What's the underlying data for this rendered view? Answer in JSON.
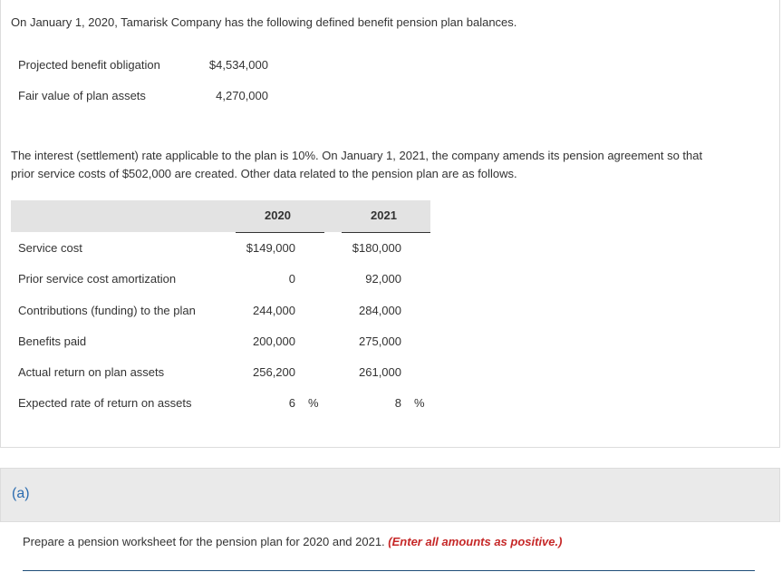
{
  "intro": "On January 1, 2020, Tamarisk Company has the following defined benefit pension plan balances.",
  "balances": [
    {
      "label": "Projected benefit obligation",
      "value": "$4,534,000"
    },
    {
      "label": "Fair value of plan assets",
      "value": "4,270,000"
    }
  ],
  "paragraph_line1": "The interest (settlement) rate applicable to the plan is 10%. On January 1, 2021, the company amends its pension agreement so that",
  "paragraph_line2": "prior service costs of $502,000 are created. Other data related to the pension plan are as follows.",
  "table": {
    "headers": [
      "2020",
      "2021"
    ],
    "rows": [
      {
        "label": "Service cost",
        "v2020": "$149,000",
        "v2021": "$180,000"
      },
      {
        "label": "Prior service cost amortization",
        "v2020": "0",
        "v2021": "92,000"
      },
      {
        "label": "Contributions (funding) to the plan",
        "v2020": "244,000",
        "v2021": "284,000"
      },
      {
        "label": "Benefits paid",
        "v2020": "200,000",
        "v2021": "275,000"
      },
      {
        "label": "Actual return on plan assets",
        "v2020": "256,200",
        "v2021": "261,000"
      },
      {
        "label": "Expected rate of return on assets",
        "v2020": "6",
        "v2021": "8",
        "unit": "%"
      }
    ]
  },
  "part_label": "(a)",
  "instruction": "Prepare a pension worksheet for the pension plan for 2020 and 2021.",
  "instruction_note": "(Enter all amounts as positive.)"
}
